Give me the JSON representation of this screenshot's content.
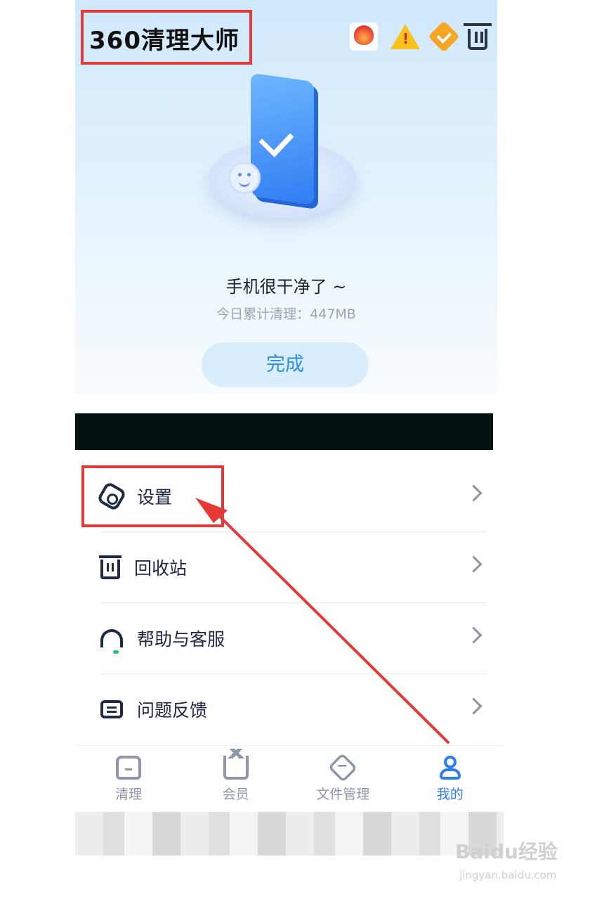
{
  "header": {
    "app_title": "360清理大师",
    "icons": [
      "hot-badge-icon",
      "warning-icon",
      "vip-gem-icon",
      "trash-icon"
    ]
  },
  "clean_result": {
    "title": "手机很干净了 ~",
    "subtitle": "今日累计清理：447MB",
    "done_label": "完成"
  },
  "menu": {
    "items": [
      {
        "label": "设置",
        "icon": "settings-gear-icon"
      },
      {
        "label": "回收站",
        "icon": "recycle-bin-icon"
      },
      {
        "label": "帮助与客服",
        "icon": "headset-icon"
      },
      {
        "label": "问题反馈",
        "icon": "feedback-icon"
      }
    ]
  },
  "bottom_nav": {
    "items": [
      {
        "label": "清理",
        "icon": "clean-icon",
        "active": false
      },
      {
        "label": "会员",
        "icon": "crown-icon",
        "active": false
      },
      {
        "label": "文件管理",
        "icon": "file-manager-icon",
        "active": false
      },
      {
        "label": "我的",
        "icon": "profile-icon",
        "active": true
      }
    ]
  },
  "colors": {
    "accent": "#2f7df2",
    "annotation": "#e53935"
  },
  "watermark": {
    "brand": "Baidu经验",
    "url": "jingyan.baidu.com"
  }
}
